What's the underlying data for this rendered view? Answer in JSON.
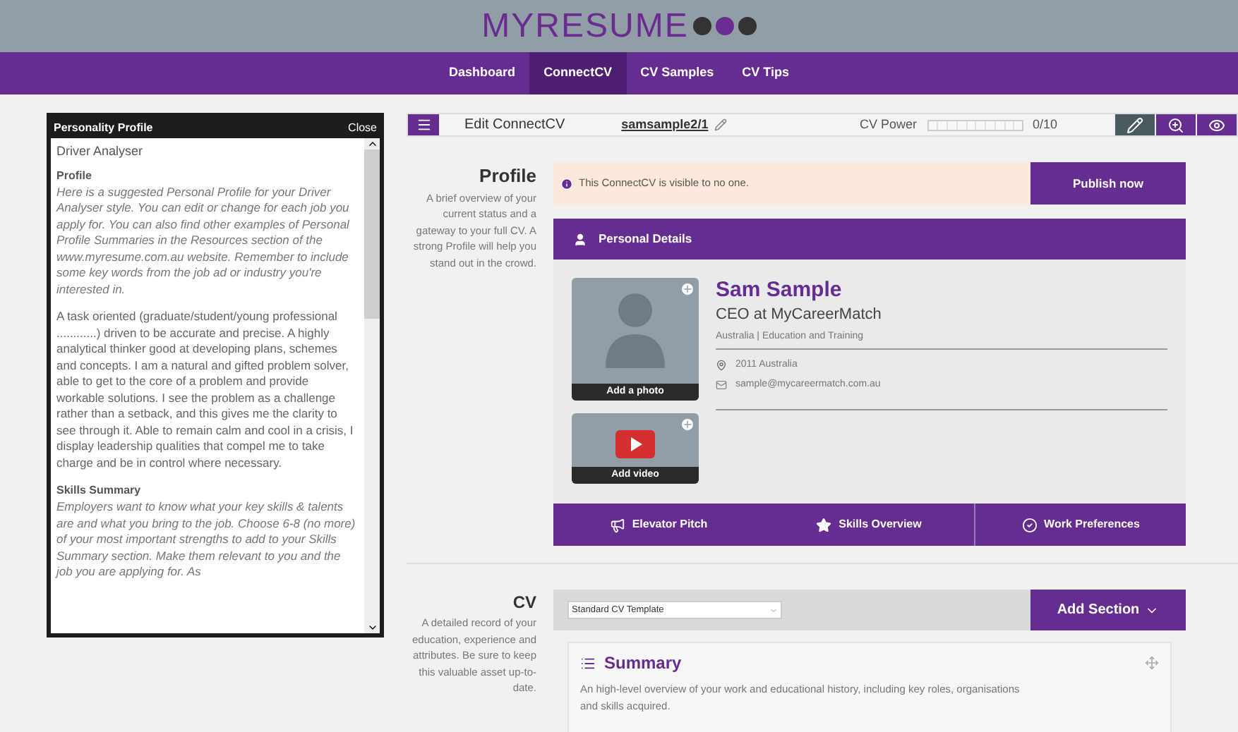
{
  "logo": {
    "text": "MYRESUME",
    "dots": [
      {
        "color": "#333333"
      },
      {
        "color": "#6a2c91"
      },
      {
        "color": "#333333"
      }
    ]
  },
  "nav": [
    {
      "label": "Dashboard",
      "selected": false
    },
    {
      "label": "ConnectCV",
      "selected": true
    },
    {
      "label": "CV Samples",
      "selected": false
    },
    {
      "label": "CV Tips",
      "selected": false
    }
  ],
  "side_panel": {
    "title": "Personality Profile",
    "close": "Close",
    "blocks": [
      {
        "kind": "heading",
        "text": "Driver Analyser"
      },
      {
        "kind": "subheading",
        "text": "Profile"
      },
      {
        "kind": "hint",
        "text": "Here is a suggested Personal Profile for your Driver Analyser style. You can edit or change for each job you apply for. You can also find other examples of Personal Profile Summaries in the Resources section of the www.myresume.com.au website. Remember to include some key words from the job ad or industry you're interested in."
      },
      {
        "kind": "body",
        "text": "A task oriented (graduate/student/young professional ............) driven to be accurate and precise. A highly analytical thinker good at developing plans, schemes and concepts. I am a natural and gifted problem solver, able to get to the core of a problem and provide workable solutions. I see the problem as a challenge rather than a setback, and this gives me the clarity to see through it. Able to remain calm and cool in a crisis, I display leadership qualities that compel me to take charge and be in control where necessary."
      },
      {
        "kind": "subheading",
        "text": "Skills Summary"
      },
      {
        "kind": "hint",
        "text": "Employers want to know what your key skills & talents are and what you bring to the job. Choose 6-8 (no more) of your most important strengths to add to your Skills Summary section. Make them relevant to you and the job you are applying for. As"
      }
    ]
  },
  "toolbar": {
    "title": "Edit ConnectCV",
    "cv_name": "samsample2/1",
    "power_label": "CV Power",
    "power_reading": "0/10",
    "tools": [
      {
        "kind": "edit",
        "selected": true
      },
      {
        "kind": "preview",
        "selected": false
      },
      {
        "kind": "view",
        "selected": false
      }
    ]
  },
  "profile": {
    "title": "Profile",
    "description": "A brief overview of your current status and a gateway to your full CV. A strong Profile will help you stand out in the crowd.",
    "alert": "This ConnectCV is visible to no one.",
    "publish": "Publish now",
    "details_title": "Personal Details",
    "add_photo": "Add a photo",
    "add_video": "Add video",
    "name": "Sam Sample",
    "job": "CEO at MyCareerMatch",
    "meta": "Australia | Education and Training",
    "location": "2011 Australia",
    "email": "sample@mycareermatch.com.au",
    "actions": [
      {
        "kind": "pitch",
        "label": "Elevator Pitch"
      },
      {
        "kind": "skills",
        "label": "Skills Overview"
      },
      {
        "kind": "prefs",
        "label": "Work Preferences"
      }
    ]
  },
  "cv": {
    "title": "CV",
    "description": "A detailed record of your education, experience and attributes. Be sure to keep this valuable asset up-to-date.",
    "template": "Standard CV Template",
    "add_section": "Add Section",
    "summary_title": "Summary",
    "summary_text": "An high-level overview of your work and educational history, including key roles, organisations and skills acquired."
  }
}
